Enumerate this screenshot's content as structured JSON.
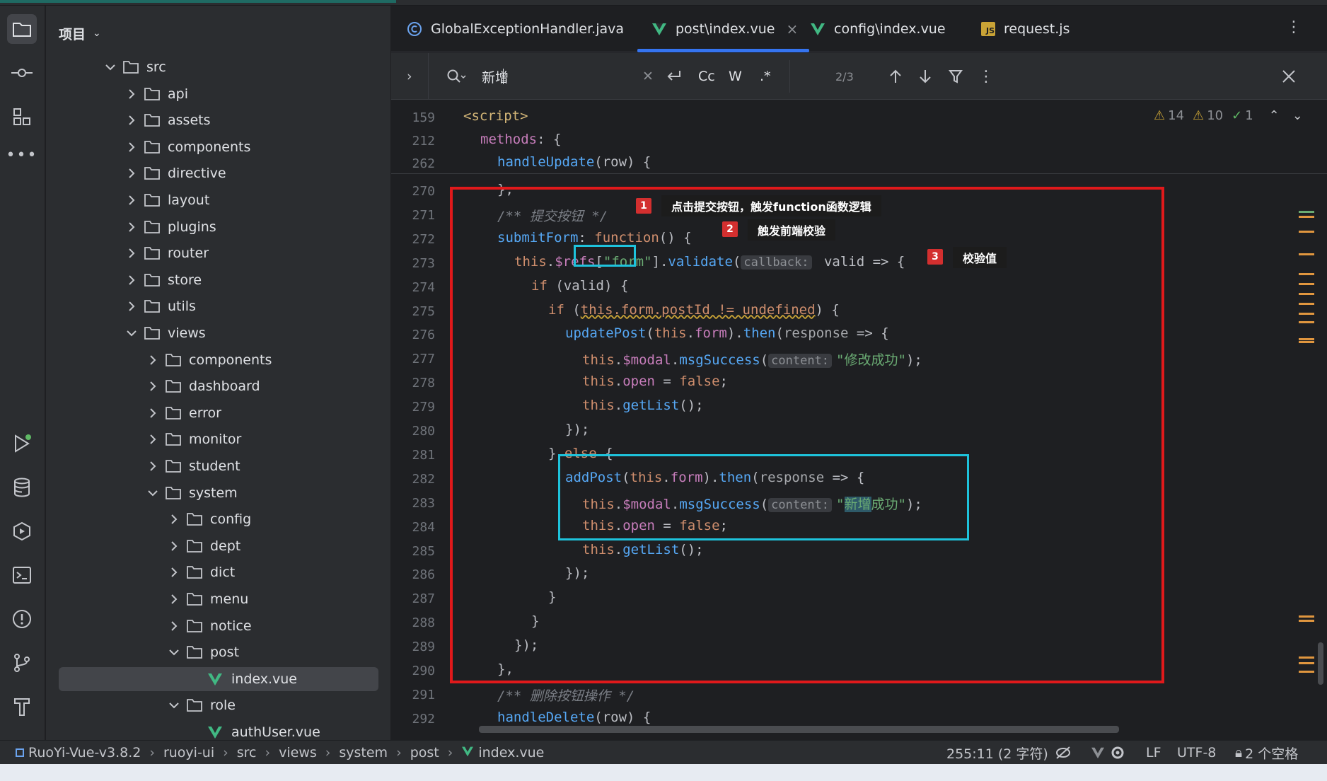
{
  "project": {
    "title": "项目"
  },
  "tree": [
    {
      "label": "src",
      "open": true,
      "depth": 0
    },
    {
      "label": "api",
      "open": false,
      "depth": 1
    },
    {
      "label": "assets",
      "open": false,
      "depth": 1
    },
    {
      "label": "components",
      "open": false,
      "depth": 1
    },
    {
      "label": "directive",
      "open": false,
      "depth": 1
    },
    {
      "label": "layout",
      "open": false,
      "depth": 1
    },
    {
      "label": "plugins",
      "open": false,
      "depth": 1
    },
    {
      "label": "router",
      "open": false,
      "depth": 1
    },
    {
      "label": "store",
      "open": false,
      "depth": 1
    },
    {
      "label": "utils",
      "open": false,
      "depth": 1
    },
    {
      "label": "views",
      "open": true,
      "depth": 1
    },
    {
      "label": "components",
      "open": false,
      "depth": 2
    },
    {
      "label": "dashboard",
      "open": false,
      "depth": 2
    },
    {
      "label": "error",
      "open": false,
      "depth": 2
    },
    {
      "label": "monitor",
      "open": false,
      "depth": 2
    },
    {
      "label": "student",
      "open": false,
      "depth": 2
    },
    {
      "label": "system",
      "open": true,
      "depth": 2
    },
    {
      "label": "config",
      "open": false,
      "depth": 3
    },
    {
      "label": "dept",
      "open": false,
      "depth": 3
    },
    {
      "label": "dict",
      "open": false,
      "depth": 3
    },
    {
      "label": "menu",
      "open": false,
      "depth": 3
    },
    {
      "label": "notice",
      "open": false,
      "depth": 3
    },
    {
      "label": "post",
      "open": true,
      "depth": 3
    },
    {
      "label": "index.vue",
      "file": true,
      "depth": 4,
      "selected": true
    },
    {
      "label": "role",
      "open": true,
      "depth": 3
    },
    {
      "label": "authUser.vue",
      "file": true,
      "depth": 4
    }
  ],
  "tabs": [
    {
      "label": "GlobalExceptionHandler.java",
      "icon": "java-class-icon"
    },
    {
      "label": "post\\index.vue",
      "icon": "vue-icon",
      "active": true,
      "close": "×"
    },
    {
      "label": "config\\index.vue",
      "icon": "vue-icon"
    },
    {
      "label": "request.js",
      "icon": "js-icon",
      "icon_text": "JS"
    }
  ],
  "search": {
    "query": "新增",
    "count": "2/3",
    "match_case": "Cc",
    "words": "W",
    "regex": ".*"
  },
  "inspections": {
    "warnings": "14",
    "weak": "10",
    "ok": "1"
  },
  "sticky": [
    {
      "ln": "159",
      "parts": [
        [
          "tg",
          "<script>"
        ]
      ],
      "indent": 0
    },
    {
      "ln": "212",
      "parts": [
        [
          "pr",
          "methods"
        ],
        [
          "",
          ": {"
        ]
      ],
      "indent": 1
    },
    {
      "ln": "262",
      "parts": [
        [
          "fn",
          "handleUpdate"
        ],
        [
          "",
          "(row) {"
        ]
      ],
      "indent": 2
    }
  ],
  "code": [
    {
      "ln": "270",
      "parts": [
        [
          "",
          "},"
        ]
      ],
      "indent": 2
    },
    {
      "ln": "271",
      "parts": [
        [
          "cm",
          "/** 提交按钮 */"
        ]
      ],
      "indent": 2
    },
    {
      "ln": "272",
      "parts": [
        [
          "fn",
          "submitForm"
        ],
        [
          "",
          ": "
        ],
        [
          "kw",
          "function"
        ],
        [
          "",
          "() {"
        ]
      ],
      "indent": 2
    },
    {
      "ln": "273",
      "parts": [
        [
          "th",
          "this"
        ],
        [
          "",
          "."
        ],
        [
          "pr",
          "$refs"
        ],
        [
          "",
          "["
        ],
        [
          "st",
          "\"form\""
        ],
        [
          "",
          "]."
        ],
        [
          "fnbox",
          "validate"
        ],
        [
          "",
          "("
        ],
        [
          "hint",
          "callback:"
        ],
        [
          "",
          " valid => {"
        ]
      ],
      "indent": 3
    },
    {
      "ln": "274",
      "parts": [
        [
          "kw",
          "if"
        ],
        [
          "",
          " (valid) {"
        ]
      ],
      "indent": 4
    },
    {
      "ln": "275",
      "parts": [
        [
          "kw",
          "if"
        ],
        [
          "",
          " ("
        ],
        [
          "sq",
          "this.form.postId != undefined"
        ],
        [
          "",
          ") {"
        ]
      ],
      "indent": 5
    },
    {
      "ln": "276",
      "parts": [
        [
          "fn",
          "updatePost"
        ],
        [
          "",
          "("
        ],
        [
          "th",
          "this"
        ],
        [
          "",
          "."
        ],
        [
          "pr",
          "form"
        ],
        [
          "",
          ")."
        ],
        [
          "fn",
          "then"
        ],
        [
          "",
          "("
        ],
        [
          "gr",
          "response"
        ],
        [
          "",
          " => {"
        ]
      ],
      "indent": 6
    },
    {
      "ln": "277",
      "parts": [
        [
          "th",
          "this"
        ],
        [
          "",
          "."
        ],
        [
          "pr",
          "$modal"
        ],
        [
          "",
          "."
        ],
        [
          "fn",
          "msgSuccess"
        ],
        [
          "",
          "("
        ],
        [
          "hint",
          "content:"
        ],
        [
          "st",
          "\"修改成功\""
        ],
        [
          "",
          ");"
        ]
      ],
      "indent": 7
    },
    {
      "ln": "278",
      "parts": [
        [
          "th",
          "this"
        ],
        [
          "",
          "."
        ],
        [
          "pr",
          "open"
        ],
        [
          "",
          " = "
        ],
        [
          "kw",
          "false"
        ],
        [
          "",
          ";"
        ]
      ],
      "indent": 7
    },
    {
      "ln": "279",
      "parts": [
        [
          "th",
          "this"
        ],
        [
          "",
          "."
        ],
        [
          "fn",
          "getList"
        ],
        [
          "",
          "();"
        ]
      ],
      "indent": 7
    },
    {
      "ln": "280",
      "parts": [
        [
          "",
          "});"
        ]
      ],
      "indent": 6
    },
    {
      "ln": "281",
      "parts": [
        [
          "",
          "} "
        ],
        [
          "kw",
          "else"
        ],
        [
          "",
          " {"
        ]
      ],
      "indent": 5
    },
    {
      "ln": "282",
      "parts": [
        [
          "fn",
          "addPost"
        ],
        [
          "",
          "("
        ],
        [
          "th",
          "this"
        ],
        [
          "",
          "."
        ],
        [
          "pr",
          "form"
        ],
        [
          "",
          ")."
        ],
        [
          "fn",
          "then"
        ],
        [
          "",
          "("
        ],
        [
          "gr",
          "response"
        ],
        [
          "",
          " => {"
        ]
      ],
      "indent": 6
    },
    {
      "ln": "283",
      "parts": [
        [
          "th",
          "this"
        ],
        [
          "",
          "."
        ],
        [
          "pr",
          "$modal"
        ],
        [
          "",
          "."
        ],
        [
          "fn",
          "msgSuccess"
        ],
        [
          "",
          "("
        ],
        [
          "hint",
          "content:"
        ],
        [
          "st",
          "\""
        ],
        [
          "hl",
          "新增"
        ],
        [
          "st",
          "成功\""
        ],
        [
          "",
          ");"
        ]
      ],
      "indent": 7
    },
    {
      "ln": "284",
      "parts": [
        [
          "th",
          "this"
        ],
        [
          "",
          "."
        ],
        [
          "pr",
          "open"
        ],
        [
          "",
          " = "
        ],
        [
          "kw",
          "false"
        ],
        [
          "",
          ";"
        ]
      ],
      "indent": 7
    },
    {
      "ln": "285",
      "parts": [
        [
          "th",
          "this"
        ],
        [
          "",
          "."
        ],
        [
          "fn",
          "getList"
        ],
        [
          "",
          "();"
        ]
      ],
      "indent": 7
    },
    {
      "ln": "286",
      "parts": [
        [
          "",
          "});"
        ]
      ],
      "indent": 6
    },
    {
      "ln": "287",
      "parts": [
        [
          "",
          "}"
        ]
      ],
      "indent": 5
    },
    {
      "ln": "288",
      "parts": [
        [
          "",
          "}"
        ]
      ],
      "indent": 4
    },
    {
      "ln": "289",
      "parts": [
        [
          "",
          "});"
        ]
      ],
      "indent": 3
    },
    {
      "ln": "290",
      "parts": [
        [
          "",
          "},"
        ]
      ],
      "indent": 2
    },
    {
      "ln": "291",
      "parts": [
        [
          "cm",
          "/** 删除按钮操作 */"
        ]
      ],
      "indent": 2
    },
    {
      "ln": "292",
      "parts": [
        [
          "fn",
          "handleDelete"
        ],
        [
          "",
          "(row) {"
        ]
      ],
      "indent": 2
    }
  ],
  "annotations": [
    {
      "num": "1",
      "text": "点击提交按钮，触发function函数逻辑"
    },
    {
      "num": "2",
      "text": "触发前端校验"
    },
    {
      "num": "3",
      "text": "校验值"
    }
  ],
  "status": {
    "breadcrumb": [
      "RuoYi-Vue-v3.8.2",
      "ruoyi-ui",
      "src",
      "views",
      "system",
      "post",
      "index.vue"
    ],
    "position": "255:11 (2 字符)",
    "line_ending": "LF",
    "encoding": "UTF-8",
    "indent": "2 个空格"
  },
  "colors": {
    "red_box": "#e0191b",
    "cyan_box": "#1ec3dc",
    "accent": "#3574f0"
  }
}
